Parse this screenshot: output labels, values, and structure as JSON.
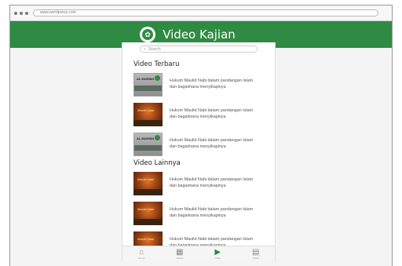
{
  "browser": {
    "url": "www.wordpress.com"
  },
  "header": {
    "title": "Video Kajian"
  },
  "search": {
    "placeholder": "Search"
  },
  "sections": {
    "latest_title": "Video Terbaru",
    "other_title": "Video Lainnya"
  },
  "videos_latest": [
    {
      "thumb": "gray",
      "thumb_text": "AL MUHSIN",
      "desc": "Hukum Maulid Nabi dalam pandangan Islam dan bagaimana menyikapinya"
    },
    {
      "thumb": "orange",
      "thumb_text": "Maulid Nabi",
      "desc": "Hukum Maulid Nabi dalam pandangan Islam dan bagaimana menyikapinya"
    },
    {
      "thumb": "gray",
      "thumb_text": "AL MUHSIN",
      "desc": "Hukum Maulid Nabi dalam pandangan Islam dan bagaimana menyikapinya"
    }
  ],
  "videos_other": [
    {
      "thumb": "orange",
      "thumb_text": "Maulid Nabi",
      "desc": "Hukum Maulid Nabi dalam pandangan Islam dan bagaimana menyikapinya"
    },
    {
      "thumb": "orange",
      "thumb_text": "Maulid Nabi",
      "desc": "Hukum Maulid Nabi dalam pandangan Islam dan bagaimana menyikapinya"
    },
    {
      "thumb": "orange",
      "thumb_text": "Maulid Nabi",
      "desc": "Hukum Maulid Nabi dalam pandangan Islam dan bagaimana menyikapinya"
    }
  ],
  "nav": [
    {
      "icon": "home-icon",
      "label": "Home",
      "active": false
    },
    {
      "icon": "calendar-icon",
      "label": "Jadwal",
      "active": false
    },
    {
      "icon": "video-icon",
      "label": "Video",
      "active": true
    },
    {
      "icon": "document-icon",
      "label": "Artikel",
      "active": false
    }
  ],
  "colors": {
    "brand": "#2f8a43"
  }
}
